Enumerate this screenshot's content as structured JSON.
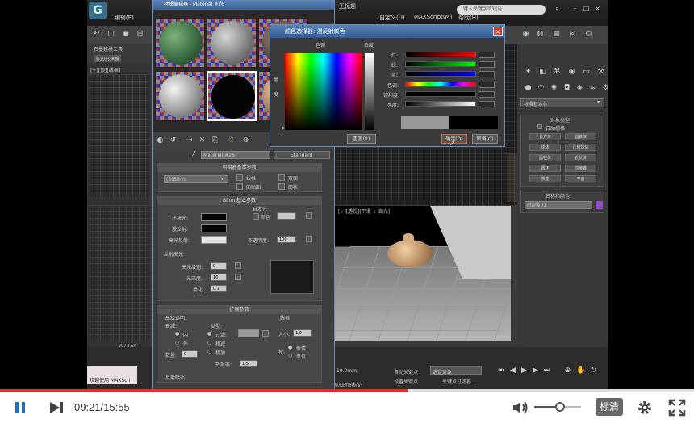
{
  "player": {
    "current_time": "09:21",
    "total_time": "15:55",
    "time_separator": "/",
    "progress": 0.587,
    "volume": 0.55,
    "quality_label": "标清",
    "accent_color": "#e02f2f"
  },
  "app": {
    "menu": {
      "edit": "编辑(E)",
      "customize": "自定义(U)",
      "maxscript": "MAXScript(M)",
      "help": "帮助(H)"
    },
    "window_title": "无标题",
    "search_placeholder": "键入关键字或短语",
    "left_panel": {
      "header": "石墨建模工具",
      "sub": "多边形建模",
      "viewport_label": "[+][顶][线框]"
    },
    "material_editor": {
      "title": "材质编辑器 - Material #26",
      "material_name": "Material #26",
      "standard_btn": "Standard",
      "shader_rollout": {
        "title": "明暗器基本参数",
        "shader": "(B)Blinn",
        "wire": "线框",
        "two_sided": "双面",
        "face_map": "面贴图",
        "faceted": "面状"
      },
      "blinn_rollout": {
        "title": "Blinn 基本参数",
        "self_illum": "自发光",
        "color": "颜色",
        "ambient": "环境光:",
        "diffuse": "漫反射:",
        "specular": "高光反射:",
        "opacity": "不透明度:",
        "opacity_value": "100",
        "specular_group": "反射高光",
        "spec_level": "高光级别:",
        "spec_level_value": "0",
        "glossiness": "光泽度:",
        "glossiness_value": "10",
        "soften": "柔化:",
        "soften_value": "0.1"
      },
      "extended_rollout": {
        "title": "扩展参数",
        "adv_transp": "高级透明",
        "falloff": "衰减:",
        "in": "内",
        "out": "外",
        "type": "类型:",
        "filter": "过滤:",
        "subtractive": "相减",
        "additive": "相加",
        "amount": "数量:",
        "amount_value": "0",
        "ior": "折射率:",
        "ior_value": "1.5",
        "wire": "线框",
        "size": "大小:",
        "size_value": "1.0",
        "in_label": "按:",
        "pixels": "像素",
        "units": "单位",
        "reflection_dimming": "反射暗淡"
      },
      "slot_counter": "0 / 100"
    },
    "color_dialog": {
      "title": "颜色选择器: 漫反射颜色",
      "hue_label": "色调",
      "whiteness_label": "白度",
      "blackness_label": "黑度",
      "red": "红:",
      "green": "绿:",
      "blue": "蓝:",
      "hue": "色调:",
      "saturation": "饱和度:",
      "value": "亮度:",
      "reset": "重置(R)",
      "ok": "确定(O)",
      "cancel": "取消(C)"
    },
    "right_panel": {
      "dropdown": "标准基本体",
      "object_type": "对象类型",
      "autogrid": "自动栅格",
      "buttons": [
        "长方体",
        "圆锥体",
        "球体",
        "几何球体",
        "圆柱体",
        "管状体",
        "圆环",
        "四棱锥",
        "茶壶",
        "平面"
      ],
      "name_color": "名称和颜色",
      "name_value": "Plane01"
    },
    "perspective_label": "[+][透视][平滑 + 高光]",
    "bottom": {
      "welcome": "欢迎使用 MAXScri",
      "auto_key": "自动关键点",
      "set_key": "设置关键点",
      "selected": "选定对象",
      "key_filters": "关键点过滤器...",
      "add_time_tag": "添加时间标记",
      "grid": "= 10.0mm"
    }
  }
}
